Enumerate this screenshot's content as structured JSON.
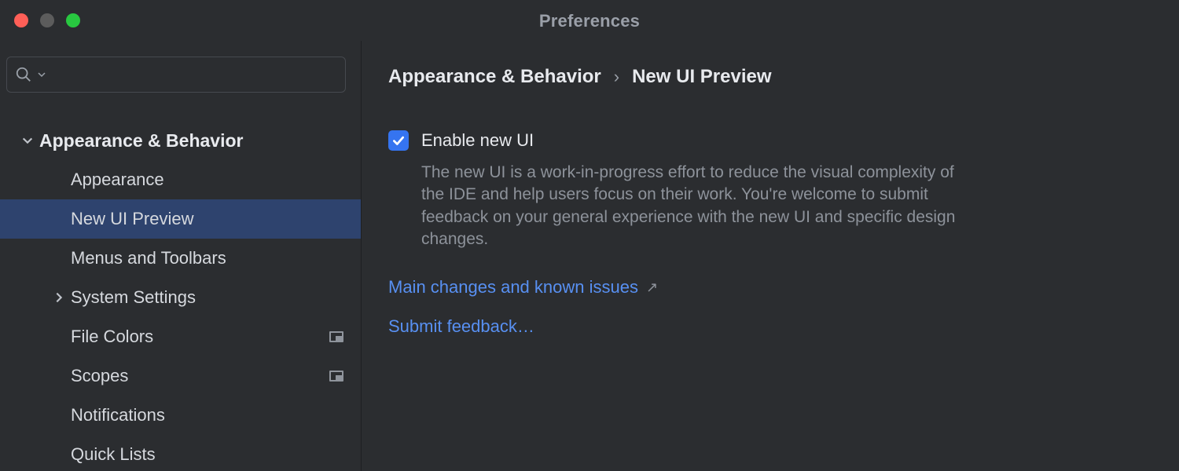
{
  "window": {
    "title": "Preferences"
  },
  "search": {
    "placeholder": ""
  },
  "sidebar": {
    "root": {
      "label": "Appearance & Behavior",
      "expanded": true
    },
    "items": [
      {
        "label": "Appearance",
        "expandable": false,
        "selected": false,
        "badge": false
      },
      {
        "label": "New UI Preview",
        "expandable": false,
        "selected": true,
        "badge": false
      },
      {
        "label": "Menus and Toolbars",
        "expandable": false,
        "selected": false,
        "badge": false
      },
      {
        "label": "System Settings",
        "expandable": true,
        "selected": false,
        "badge": false
      },
      {
        "label": "File Colors",
        "expandable": false,
        "selected": false,
        "badge": true
      },
      {
        "label": "Scopes",
        "expandable": false,
        "selected": false,
        "badge": true
      },
      {
        "label": "Notifications",
        "expandable": false,
        "selected": false,
        "badge": false
      },
      {
        "label": "Quick Lists",
        "expandable": false,
        "selected": false,
        "badge": false
      }
    ]
  },
  "breadcrumb": {
    "parent": "Appearance & Behavior",
    "current": "New UI Preview"
  },
  "setting": {
    "checkbox_label": "Enable new UI",
    "checked": true,
    "description": "The new UI is a work-in-progress effort to reduce the visual complexity of the IDE and help users focus on their work. You're welcome to submit feedback on your general experience with the new UI and specific design changes."
  },
  "links": {
    "changes": "Main changes and known issues",
    "feedback": "Submit feedback…"
  },
  "colors": {
    "accent": "#3574f0",
    "link": "#5890f2",
    "selection": "#2e436e"
  }
}
